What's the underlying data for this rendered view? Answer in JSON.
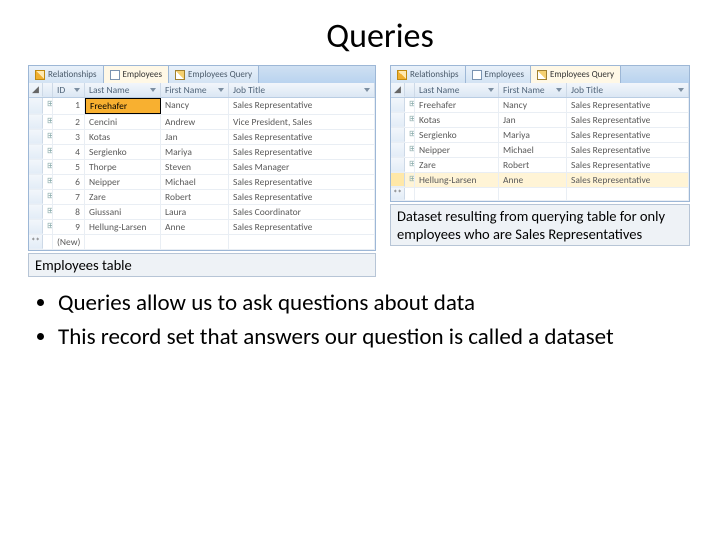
{
  "title": "Queries",
  "tabs": [
    {
      "label": "Relationships",
      "name": "tab-relationships",
      "icon": "ico-rel",
      "active": false
    },
    {
      "label": "Employees",
      "name": "tab-employees",
      "icon": "ico-tbl",
      "active_left": true,
      "active_right": false
    },
    {
      "label": "Employees Query",
      "name": "tab-employees-query",
      "icon": "ico-qry",
      "active_left": false,
      "active_right": true
    }
  ],
  "left_columns": [
    {
      "key": "expand",
      "label": "",
      "dd": false
    },
    {
      "key": "id",
      "label": "ID",
      "dd": true
    },
    {
      "key": "last",
      "label": "Last Name",
      "dd": true
    },
    {
      "key": "first",
      "label": "First Name",
      "dd": true
    },
    {
      "key": "job",
      "label": "Job Title",
      "dd": true
    }
  ],
  "left_rows": [
    {
      "id": "1",
      "last": "Freehafer",
      "first": "Nancy",
      "job": "Sales Representative",
      "selected": true
    },
    {
      "id": "2",
      "last": "Cencini",
      "first": "Andrew",
      "job": "Vice President, Sales"
    },
    {
      "id": "3",
      "last": "Kotas",
      "first": "Jan",
      "job": "Sales Representative"
    },
    {
      "id": "4",
      "last": "Sergienko",
      "first": "Mariya",
      "job": "Sales Representative"
    },
    {
      "id": "5",
      "last": "Thorpe",
      "first": "Steven",
      "job": "Sales Manager"
    },
    {
      "id": "6",
      "last": "Neipper",
      "first": "Michael",
      "job": "Sales Representative"
    },
    {
      "id": "7",
      "last": "Zare",
      "first": "Robert",
      "job": "Sales Representative"
    },
    {
      "id": "8",
      "last": "Giussani",
      "first": "Laura",
      "job": "Sales Coordinator"
    },
    {
      "id": "9",
      "last": "Hellung-Larsen",
      "first": "Anne",
      "job": "Sales Representative"
    }
  ],
  "left_new_placeholder": "(New)",
  "right_columns": [
    {
      "key": "expand",
      "label": "",
      "dd": false
    },
    {
      "key": "last",
      "label": "Last Name",
      "dd": true
    },
    {
      "key": "first",
      "label": "First Name",
      "dd": true
    },
    {
      "key": "job",
      "label": "Job Title",
      "dd": true
    }
  ],
  "right_rows": [
    {
      "last": "Freehafer",
      "first": "Nancy",
      "job": "Sales Representative"
    },
    {
      "last": "Kotas",
      "first": "Jan",
      "job": "Sales Representative"
    },
    {
      "last": "Sergienko",
      "first": "Mariya",
      "job": "Sales Representative"
    },
    {
      "last": "Neipper",
      "first": "Michael",
      "job": "Sales Representative"
    },
    {
      "last": "Zare",
      "first": "Robert",
      "job": "Sales Representative"
    },
    {
      "last": "Hellung-Larsen",
      "first": "Anne",
      "job": "Sales Representative",
      "highlight": true
    }
  ],
  "caption_left": "Employees table",
  "caption_right": "Dataset resulting from querying table for only employees who are Sales Representatives",
  "bullets": [
    "Queries allow us to ask questions about data",
    "This record set that answers our question is called a dataset"
  ]
}
